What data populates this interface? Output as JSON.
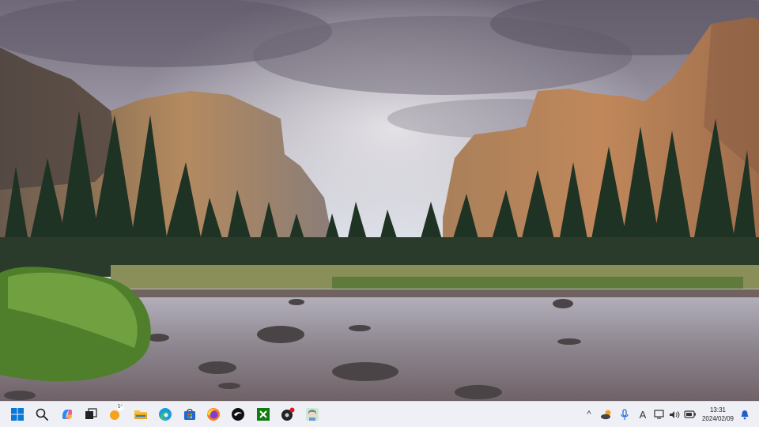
{
  "desktop": {
    "wallpaper": "mountain-valley-river-landscape"
  },
  "taskbar": {
    "pinned": [
      {
        "name": "start-button",
        "icon": "windows-logo-icon"
      },
      {
        "name": "search-button",
        "icon": "search-icon"
      },
      {
        "name": "copilot-button",
        "icon": "copilot-icon"
      },
      {
        "name": "task-view-button",
        "icon": "task-view-icon"
      },
      {
        "name": "widgets-button",
        "icon": "weather-sun-icon"
      },
      {
        "name": "file-explorer-button",
        "icon": "folder-icon"
      },
      {
        "name": "edge-button",
        "icon": "edge-icon"
      },
      {
        "name": "store-button",
        "icon": "store-icon"
      },
      {
        "name": "firefox-button",
        "icon": "firefox-icon"
      },
      {
        "name": "app-round-button",
        "icon": "round-app-icon"
      },
      {
        "name": "xbox-button",
        "icon": "xbox-icon"
      },
      {
        "name": "media-app-button",
        "icon": "media-app-icon"
      },
      {
        "name": "anime-app-button",
        "icon": "avatar-app-icon"
      }
    ],
    "widgets_temp": "5°",
    "tray": {
      "chevron": "^",
      "ime_label": "A"
    },
    "clock": {
      "time": "13:31",
      "date": "2024/02/09"
    },
    "colors": {
      "background": "#eef0f6",
      "accent": "#0078d4"
    }
  }
}
